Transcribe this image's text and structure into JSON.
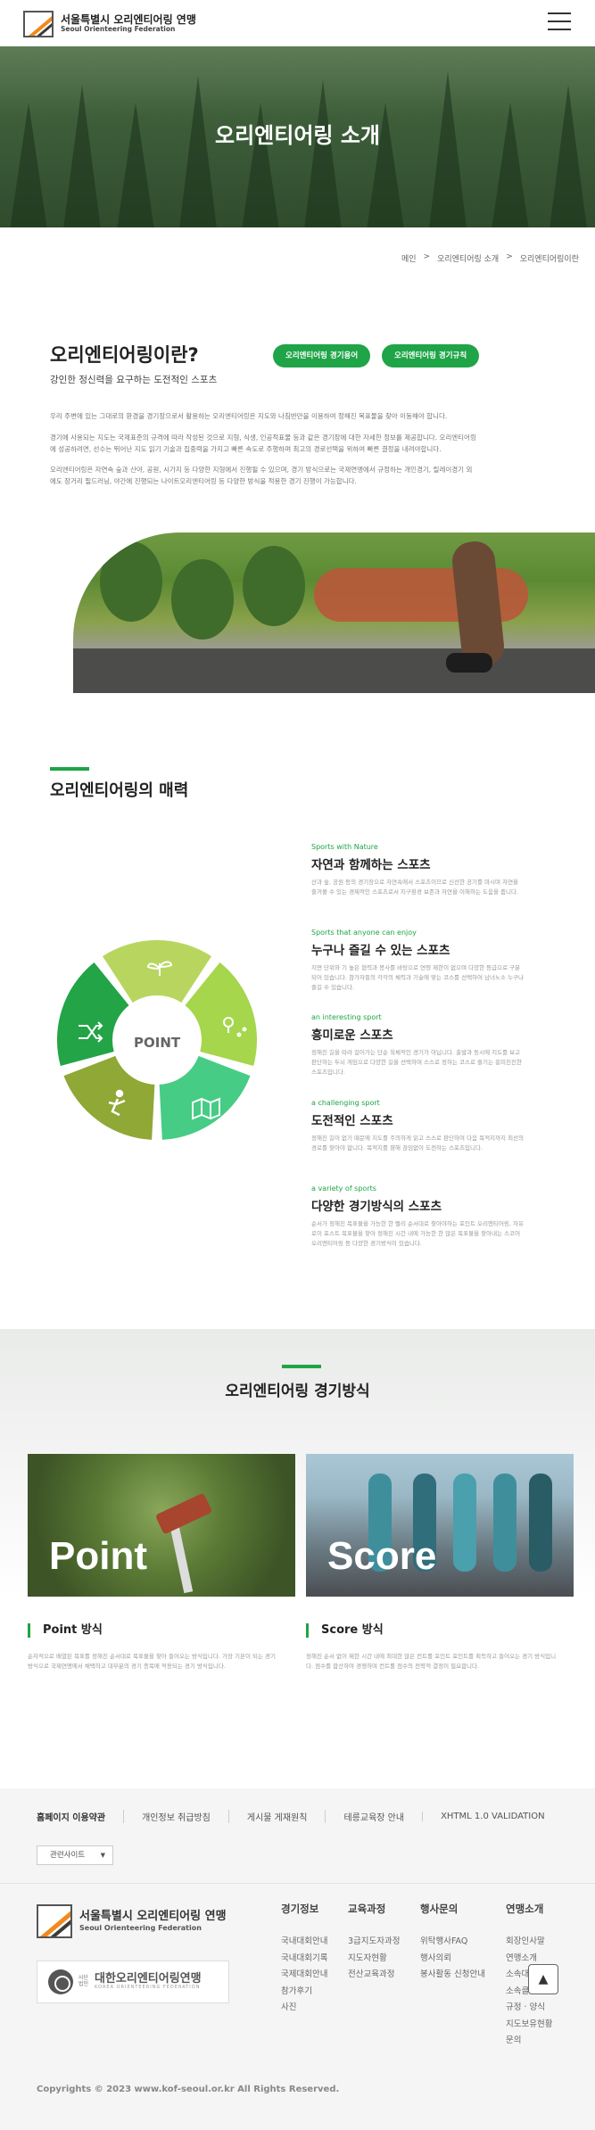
{
  "header": {
    "org_name": "서울특별시 오리엔티어링 연맹",
    "org_name_en": "Seoul Orienteering Federation",
    "menu_icon": "hamburger-menu-icon"
  },
  "hero": {
    "title": "오리엔티어링 소개"
  },
  "breadcrumb": [
    "메인",
    "오리엔티어링 소개",
    "오리엔티어링이란"
  ],
  "intro": {
    "title": "오리엔티어링이란?",
    "subtitle": "강인한 정신력을 요구하는 도전적인 스포츠",
    "buttons": [
      "오리엔티어링 경기용어",
      "오리엔티어링 경기규칙"
    ],
    "paragraphs": [
      "우리 주변에 있는 그대로의 환경을 경기장으로서 활용하는 오리엔티어링은 지도와 나침반만을 이용하여 정해진 목표물을 찾아 이동해야 합니다.",
      "경기에 사용되는 지도는 국제표준의 규격에 따라 작성된 것으로 지형, 식생, 인공적표물 등과 같은 경기장에 대한 자세한 정보를 제공합니다. 오리엔티어링에 성공하려면, 선수는 뛰어난 지도 읽기 기술과 집중력을 가지고 빠른 속도로 주행하며 최고의 경로선택을 위하여 빠른 결정을 내려야합니다.",
      "오리엔티어링은 자연속 숲과 산야, 공원, 시가지 등 다양한 지형에서 진행될 수 있으며, 경기 방식으로는 국제연맹에서 규정하는 개인경기, 릴레이경기 외에도 장거리 필드러닝, 야간에 진행되는 나이트오리엔티어링 등 다양한 방식을 적용한 경기 진행이 가능합니다."
    ]
  },
  "charm": {
    "title": "오리엔티어링의 매력",
    "center_label": "POINT",
    "features": [
      {
        "en": "Sports with Nature",
        "kr": "자연과 함께하는 스포츠",
        "desc": "산과 숲, 공원 등의 경기장으로 자연속에서 스포츠이므로 신선한 공기를 마시며 자연을 즐겨볼 수 있는 경제적인 스포츠로서 지구환경 보존과 자연을 이해하는 도움을 줍니다."
      },
      {
        "en": "Sports that anyone can enjoy",
        "kr": "누구나 즐길 수 있는 스포츠",
        "desc": "지면 단위와 기 높은 협력과 봉사를 바탕으로 연령 제한이 없으며 다양한 등급으로 구분되어 있습니다. 참가자들의 각각의 체력과 기술에 맞는 코스를 선택하여 남녀노소 누구나 즐길 수 있습니다."
      },
      {
        "en": "an interesting sport",
        "kr": "흥미로운 스포츠",
        "desc": "정해진 길을 따라 걸어가는 단순 육체적인 경기가 아닙니다. 출발과 동시에 지도를 보고 판단하는 두뇌 게임으로 다양한 길을 선택하며 스스로 정하는 코스로 즐기는 흥미진진한 스포츠입니다."
      },
      {
        "en": "a challenging sport",
        "kr": "도전적인 스포츠",
        "desc": "정해진 길이 없기 때문에 지도를 주의하게 읽고 스스로 판단하여 다음 목적지까지 최선의 경로를 찾아야 합니다. 목적지를 향해 끊임없이 도전하는 스포츠입니다."
      },
      {
        "en": "a variety of sports",
        "kr": "다양한 경기방식의 스포츠",
        "desc": "순서가 정해진 목표물을 가능한 한 빨리 순서대로 찾아야하는 포인트 오리엔티어링, 자유로이 포스트 목표물을 찾아 정해진 시간 내에 가능한 한 많은 목표물을 찾아내는 스코어 오리엔티어링 등 다양한 경기방식이 있습니다."
      }
    ],
    "icons": [
      "sprout-icon",
      "map-pin-icon",
      "map-icon",
      "runner-icon",
      "shuffle-icon"
    ],
    "accent_colors": [
      "#b8d65f",
      "#a5d64c",
      "#46cc85",
      "#8fa836",
      "#23a447"
    ]
  },
  "method": {
    "title": "오리엔티어링 경기방식",
    "cards": [
      {
        "big": "Point",
        "name": "Point 방식",
        "desc": "순차적으로 배열된 목표를 정해진 순서대로 목표물을 찾아 들어오는 방식입니다. 가장 기본이 되는 경기 방식으로 국제연맹에서 채택하고 대부분의 경기 종목에 적용되는 경기 방식입니다."
      },
      {
        "big": "Score",
        "name": "Score 방식",
        "desc": "정해진 순서 없이 제한 시간 내에 최대한 많은 컨트롤 포인트 포인트를 획득하고 들어오는 경기 방식입니다. 점수를 합산하여 경쟁하며 컨트롤 점수의 전략적 결정이 필요합니다."
      }
    ]
  },
  "footer": {
    "links": [
      "홈페이지 이용약관",
      "개인정보 취급방침",
      "게시물 게재원칙",
      "테릉교육장 안내",
      "XHTML 1.0 VALIDATION"
    ],
    "related_label": "관련사이트",
    "org_name": "서울특별시 오리엔티어링 연맹",
    "org_name_en": "Seoul Orienteering Federation",
    "kof_small": "사단법인",
    "kof_name": "대한오리엔티어링연맹",
    "kof_en": "KOREA ORIENTEERING FEDERATION",
    "columns": [
      {
        "heading": "경기정보",
        "items": [
          "국내대회안내",
          "국내대회기록",
          "국제대회안내",
          "참가후기",
          "사진"
        ]
      },
      {
        "heading": "교육과정",
        "items": [
          "3급지도자과정",
          "지도자현황",
          "전산교육과정"
        ]
      },
      {
        "heading": "행사문의",
        "items": [
          "위탁행사FAQ",
          "행사의뢰",
          "봉사활동 신청안내"
        ]
      },
      {
        "heading": "연맹소개",
        "items": [
          "회장인사말",
          "연맹소개",
          "소속대표선수",
          "소속클럽",
          "규정 · 양식",
          "지도보유현황",
          "문의"
        ]
      }
    ],
    "copyright": "Copyrights © 2023 www.kof-seoul.or.kr All Rights Reserved.",
    "totop_icon": "arrow-up-icon"
  }
}
